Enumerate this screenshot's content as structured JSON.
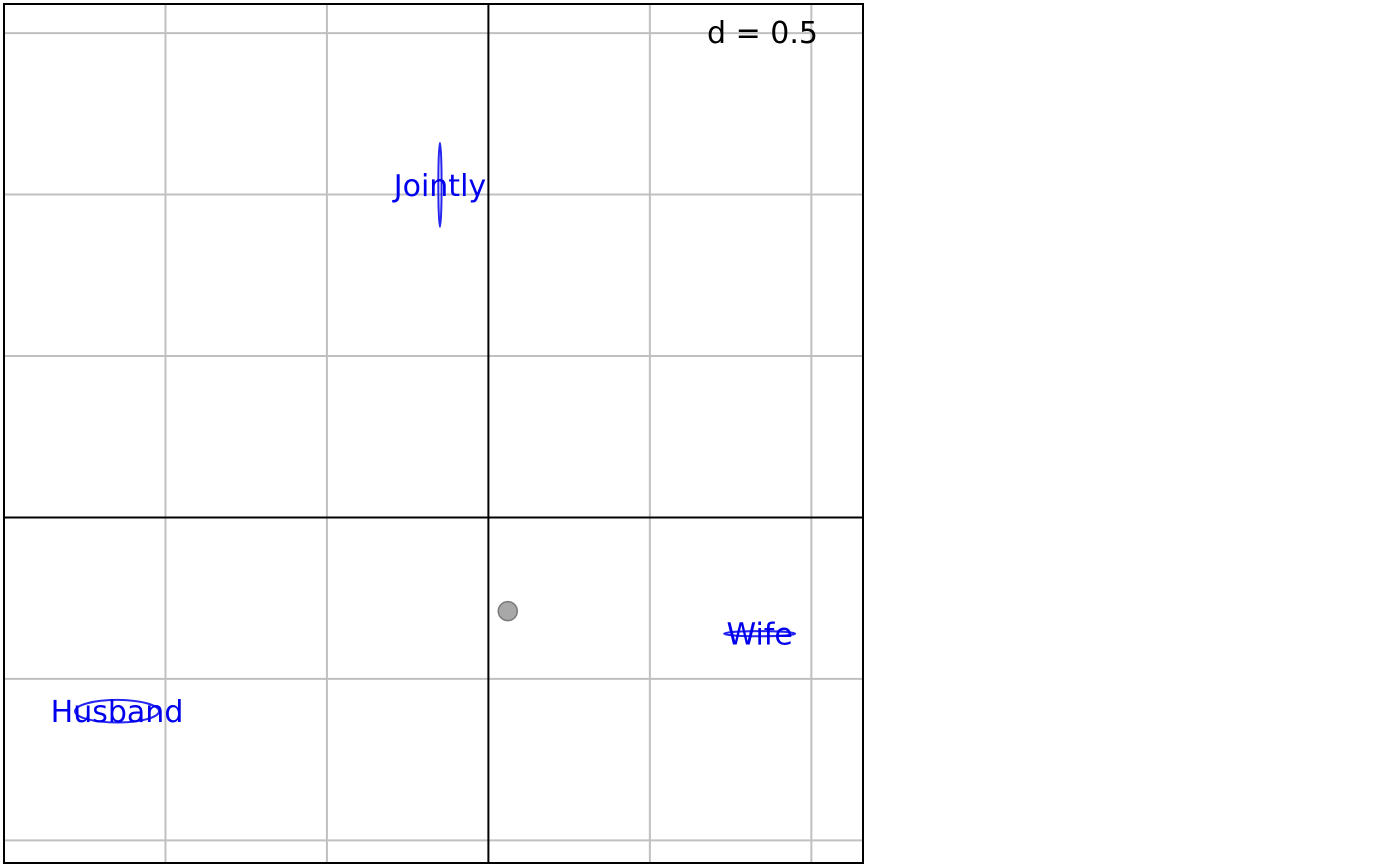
{
  "chart_data": {
    "type": "scatter",
    "scale_label": "d = 0.5",
    "grid_step": 0.5,
    "xlim": [
      -1.5,
      1.16
    ],
    "ylim": [
      -1.07,
      1.59
    ],
    "axes_origin": [
      0,
      0
    ],
    "points": [
      {
        "label": "Jointly",
        "x": -0.15,
        "y": 1.03,
        "ellipse_rx": 0.005,
        "ellipse_ry": 0.13
      },
      {
        "label": "Wife",
        "x": 0.84,
        "y": -0.36,
        "ellipse_rx": 0.11,
        "ellipse_ry": 0.008
      },
      {
        "label": "Husband",
        "x": -1.15,
        "y": -0.6,
        "ellipse_rx": 0.13,
        "ellipse_ry": 0.035
      }
    ],
    "centroid": {
      "x": 0.06,
      "y": -0.29
    },
    "colors": {
      "points": "#0000ee",
      "grid": "#c0c0c0",
      "axes": "#000000",
      "centroid": "#999999"
    },
    "grid": true
  }
}
